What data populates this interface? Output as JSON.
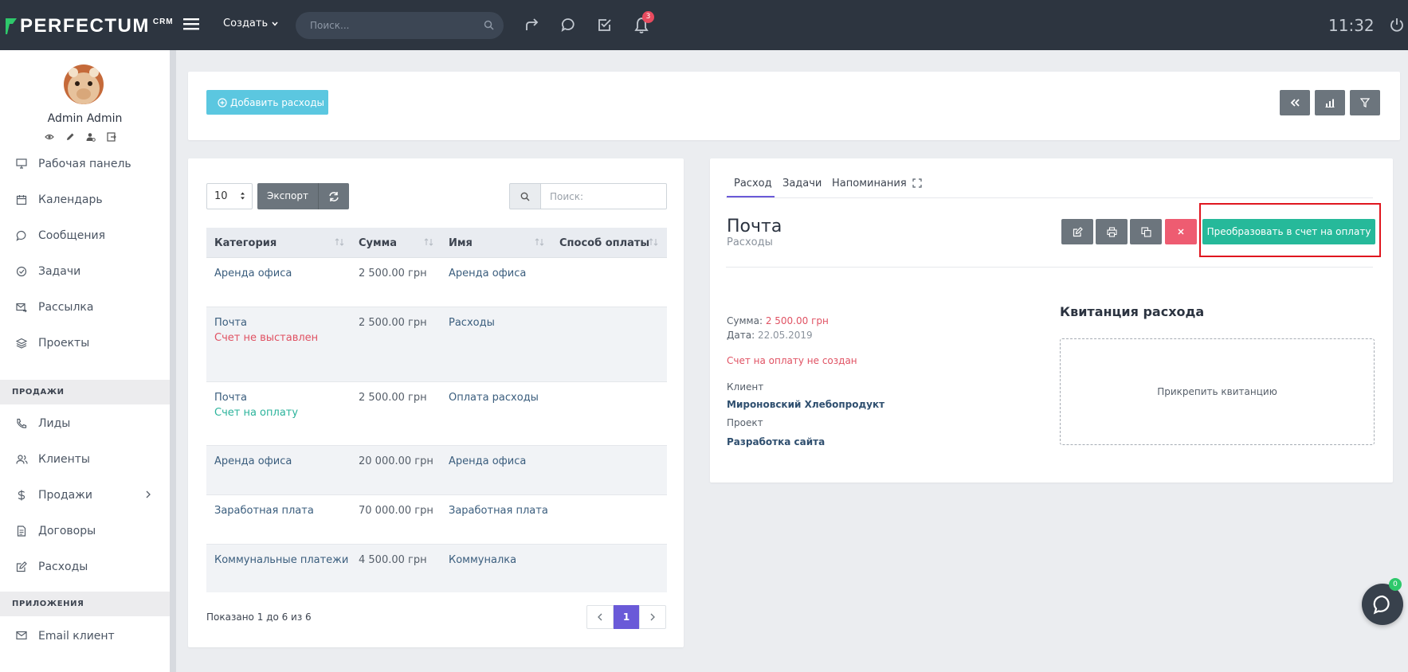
{
  "topbar": {
    "logo_text": "PERFECTUM",
    "logo_sup": "CRM",
    "create_label": "Создать",
    "search_placeholder": "Поиск...",
    "notifications_count": "3",
    "clock": "11:32"
  },
  "sidebar": {
    "user_name": "Admin Admin",
    "items_main": [
      {
        "label": "Рабочая панель",
        "icon": "monitor-icon"
      },
      {
        "label": "Календарь",
        "icon": "calendar-icon"
      },
      {
        "label": "Сообщения",
        "icon": "chat-icon"
      },
      {
        "label": "Задачи",
        "icon": "check-circle-icon"
      },
      {
        "label": "Рассылка",
        "icon": "mail-send-icon"
      },
      {
        "label": "Проекты",
        "icon": "layers-icon"
      }
    ],
    "section_sales": "ПРОДАЖИ",
    "items_sales": [
      {
        "label": "Лиды",
        "icon": "phone-icon"
      },
      {
        "label": "Клиенты",
        "icon": "users-icon"
      },
      {
        "label": "Продажи",
        "icon": "dollar-icon"
      },
      {
        "label": "Договоры",
        "icon": "document-icon"
      },
      {
        "label": "Расходы",
        "icon": "edit-icon"
      }
    ],
    "section_apps": "ПРИЛОЖЕНИЯ",
    "items_apps": [
      {
        "label": "Email клиент",
        "icon": "envelope-icon"
      }
    ]
  },
  "toolbar": {
    "add_expense_label": "Добавить расходы"
  },
  "table_controls": {
    "page_length": "10",
    "export_label": "Экспорт",
    "search_placeholder": "Поиск:"
  },
  "table": {
    "columns": [
      "Категория",
      "Сумма",
      "Имя",
      "Способ оплаты"
    ],
    "rows": [
      {
        "category": "Аренда офиса",
        "status": "",
        "status_type": "",
        "amount": "2 500.00 грн",
        "name": "Аренда офиса",
        "payment": ""
      },
      {
        "category": "Почта",
        "status": "Счет не выставлен",
        "status_type": "red",
        "amount": "2 500.00 грн",
        "name": "Расходы",
        "payment": ""
      },
      {
        "category": "Почта",
        "status": "Счет на оплату",
        "status_type": "green",
        "amount": "2 500.00 грн",
        "name": "Оплата расходы",
        "payment": ""
      },
      {
        "category": "Аренда офиса",
        "status": "",
        "status_type": "",
        "amount": "20 000.00 грн",
        "name": "Аренда офиса",
        "payment": ""
      },
      {
        "category": "Заработная плата",
        "status": "",
        "status_type": "",
        "amount": "70 000.00 грн",
        "name": "Заработная плата",
        "payment": ""
      },
      {
        "category": "Коммунальные платежи",
        "status": "",
        "status_type": "",
        "amount": "4 500.00 грн",
        "name": "Коммуналка",
        "payment": ""
      }
    ],
    "shown_text": "Показано 1 до 6 из 6",
    "current_page": "1"
  },
  "detail": {
    "tabs": [
      "Расход",
      "Задачи",
      "Напоминания"
    ],
    "title": "Почта",
    "subtitle": "Расходы",
    "convert_label": "Преобразовать в счет на оплату",
    "sum_label": "Сумма:",
    "sum_value": "2 500.00 грн",
    "date_label": "Дата:",
    "date_value": "22.05.2019",
    "invoice_status": "Счет на оплату не создан",
    "client_label": "Клиент",
    "client_value": "Мироновский Хлебопродукт",
    "project_label": "Проект",
    "project_value": "Разработка сайта",
    "receipt_title": "Квитанция расхода",
    "attach_label": "Прикрепить квитанцию"
  },
  "chat": {
    "badge": "0"
  },
  "colors": {
    "topbar": "#2d3540",
    "accent_purple": "#6a5ad8",
    "convert_green": "#26b99a",
    "add_button": "#5bc7e0",
    "danger": "#ee5c71",
    "highlight": "#e0161f"
  }
}
